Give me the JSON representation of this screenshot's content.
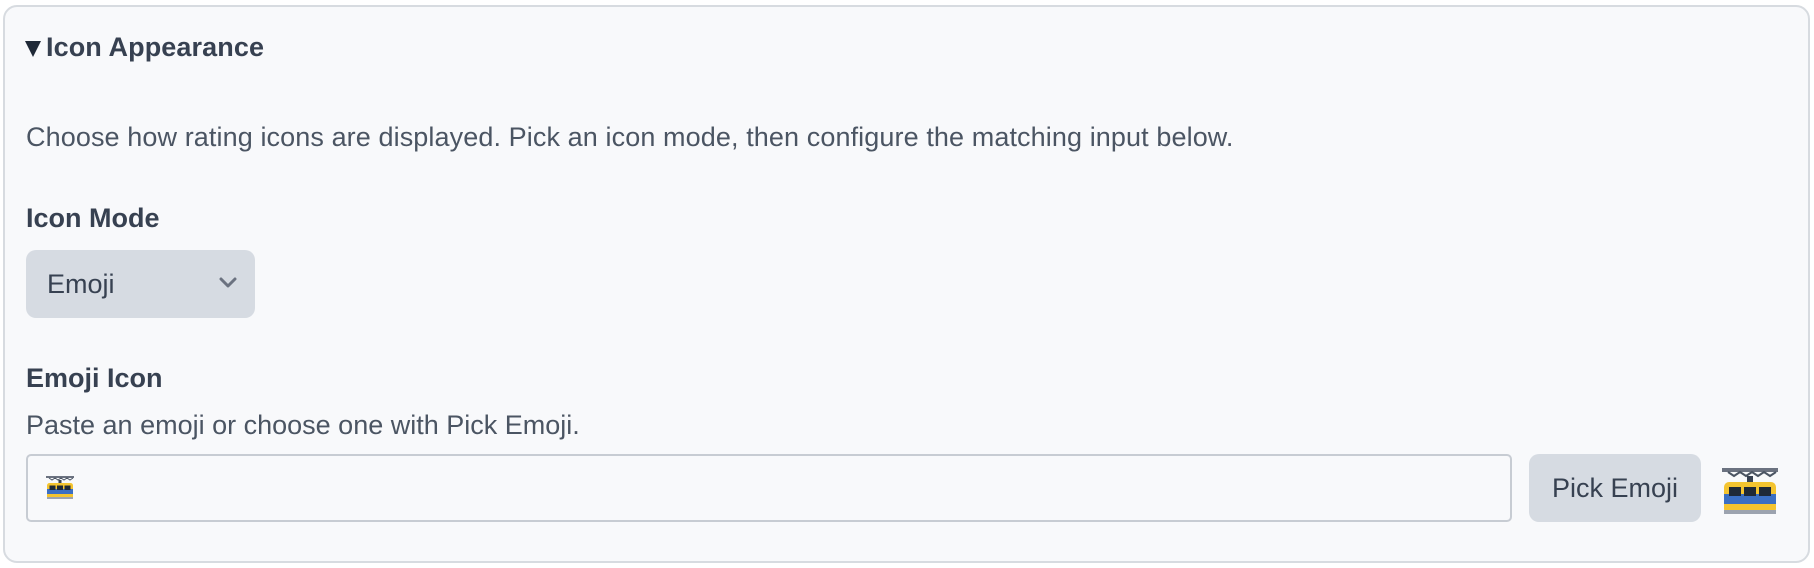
{
  "section": {
    "title": "Icon Appearance",
    "expanded": true,
    "description": "Choose how rating icons are displayed. Pick an icon mode, then configure the matching input below."
  },
  "icon_mode": {
    "label": "Icon Mode",
    "selected": "Emoji"
  },
  "emoji_icon": {
    "label": "Emoji Icon",
    "help": "Paste an emoji or choose one with Pick Emoji.",
    "value_icon": "suspension-railway-emoji",
    "pick_button_label": "Pick Emoji",
    "preview_icon": "suspension-railway-emoji"
  },
  "colors": {
    "panel_bg": "#f8f9fb",
    "panel_border": "#d7dbe0",
    "control_bg": "#d6dbe2",
    "text": "#374151"
  }
}
